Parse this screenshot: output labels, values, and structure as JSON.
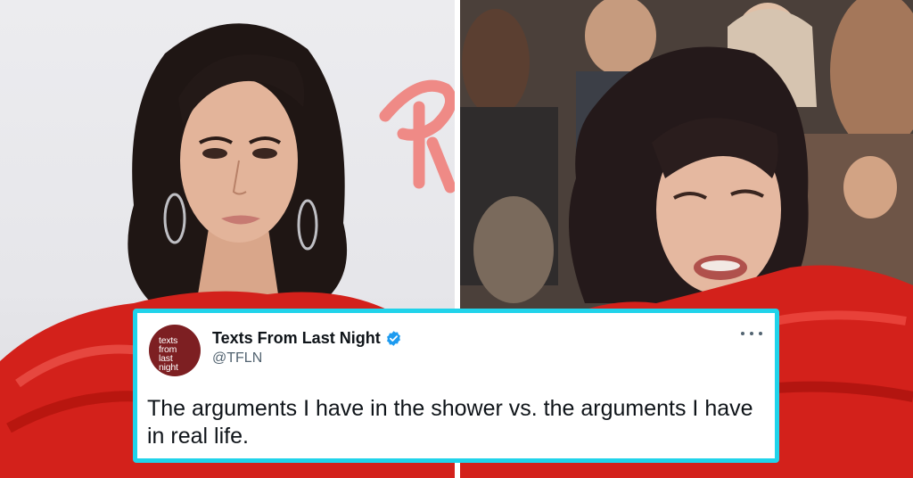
{
  "images": {
    "left_photo": {
      "subject": "woman with dark hair, hoop earrings, red ruffled outfit posing at a photo wall",
      "backdrop_logo_text": "R"
    },
    "right_photo": {
      "subject": "woman in red outfit in an audience crowd making a comedic face"
    }
  },
  "tweet": {
    "avatar_lines": [
      "texts",
      "from",
      "last",
      "night"
    ],
    "display_name": "Texts From Last Night",
    "handle": "@TFLN",
    "text": "The arguments I have in the shower vs. the arguments I have in real life.",
    "verified": true
  },
  "colors": {
    "card_border": "#20d3ea",
    "avatar_bg": "#7d1f22",
    "verified_blue": "#1d9bf0",
    "outfit_red": "#d3211b"
  },
  "icons": {
    "verified": "verified-badge-icon",
    "more": "more-options-icon"
  }
}
